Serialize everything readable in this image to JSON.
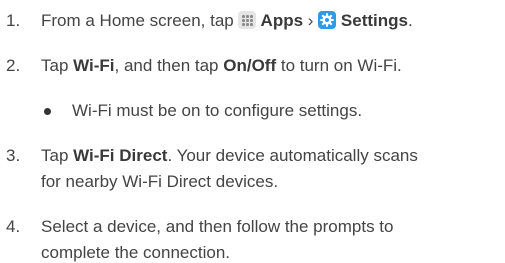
{
  "steps": [
    {
      "number": "1.",
      "segments": [
        {
          "text": "From a Home screen, tap "
        },
        {
          "icon": "apps-icon"
        },
        {
          "text": " Apps",
          "bold": true
        },
        {
          "text": " › "
        },
        {
          "icon": "settings-icon"
        },
        {
          "text": " Settings",
          "bold": true
        },
        {
          "text": "."
        }
      ]
    },
    {
      "number": "2.",
      "segments": [
        {
          "text": "Tap "
        },
        {
          "text": "Wi-Fi",
          "bold": true
        },
        {
          "text": ", and then tap "
        },
        {
          "text": "On/Off",
          "bold": true
        },
        {
          "text": " to turn on Wi-Fi."
        }
      ],
      "bullet": "Wi-Fi must be on to configure settings."
    },
    {
      "number": "3.",
      "segments": [
        {
          "text": "Tap "
        },
        {
          "text": "Wi-Fi Direct",
          "bold": true
        },
        {
          "text": ". Your device automatically scans"
        }
      ],
      "continuation": "for nearby Wi-Fi Direct devices."
    },
    {
      "number": "4.",
      "segments": [
        {
          "text": "Select a device, and then follow the prompts to"
        }
      ],
      "continuation": "complete the connection."
    }
  ]
}
